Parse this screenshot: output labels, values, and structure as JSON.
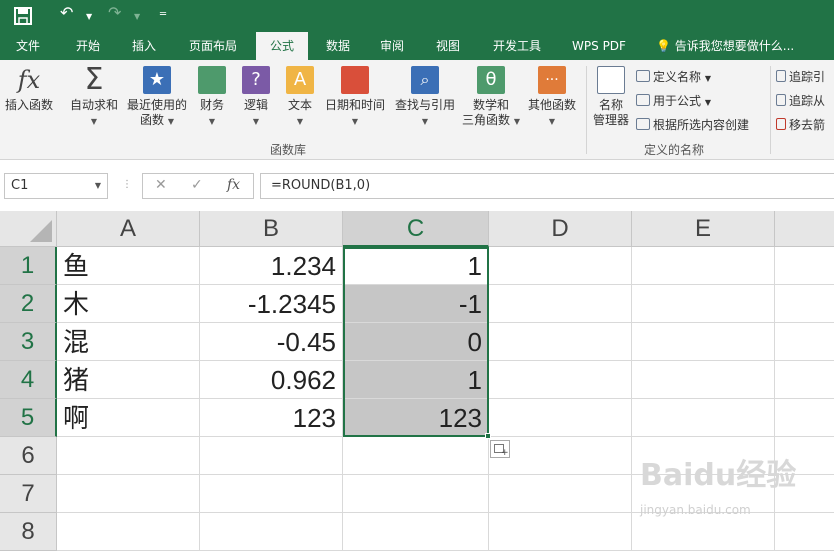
{
  "quick_access": {
    "custom_glyph": "═"
  },
  "tabs": [
    {
      "label": "文件",
      "active": false
    },
    {
      "label": "开始",
      "active": false
    },
    {
      "label": "插入",
      "active": false
    },
    {
      "label": "页面布局",
      "active": false
    },
    {
      "label": "公式",
      "active": true
    },
    {
      "label": "数据",
      "active": false
    },
    {
      "label": "审阅",
      "active": false
    },
    {
      "label": "视图",
      "active": false
    },
    {
      "label": "开发工具",
      "active": false
    },
    {
      "label": "WPS PDF",
      "active": false
    }
  ],
  "tell_me": "告诉我您想要做什么...",
  "ribbon": {
    "function_library": {
      "insert_function": "插入函数",
      "autosum": "自动求和",
      "recent_line1": "最近使用的",
      "recent_line2": "函数",
      "financial": "财务",
      "logical": "逻辑",
      "text": "文本",
      "datetime": "日期和时间",
      "lookup": "查找与引用",
      "math_line1": "数学和",
      "math_line2": "三角函数",
      "other": "其他函数",
      "group_label": "函数库"
    },
    "defined_names": {
      "manager_line1": "名称",
      "manager_line2": "管理器",
      "define_name": "定义名称",
      "use_in_formula": "用于公式",
      "create_from_selection": "根据所选内容创建",
      "group_label": "定义的名称"
    },
    "auditing": {
      "trace_precedents": "追踪引",
      "trace_dependents": "追踪从",
      "remove_arrows": "移去箭"
    }
  },
  "formula_bar": {
    "name_box": "C1",
    "formula": "=ROUND(B1,0)",
    "cancel_glyph": "✕",
    "enter_glyph": "✓",
    "fx_glyph": "fx"
  },
  "columns": [
    "A",
    "B",
    "C",
    "D",
    "E"
  ],
  "rows": [
    "1",
    "2",
    "3",
    "4",
    "5",
    "6",
    "7",
    "8"
  ],
  "cells": [
    {
      "a": "鱼",
      "b": "1.234",
      "c": "1"
    },
    {
      "a": "木",
      "b": "-1.2345",
      "c": "-1"
    },
    {
      "a": "混",
      "b": "-0.45",
      "c": "0"
    },
    {
      "a": "猪",
      "b": "0.962",
      "c": "1"
    },
    {
      "a": "啊",
      "b": "123",
      "c": "123"
    }
  ],
  "watermark": "Baidu经验",
  "watermark_url": "jingyan.baidu.com"
}
